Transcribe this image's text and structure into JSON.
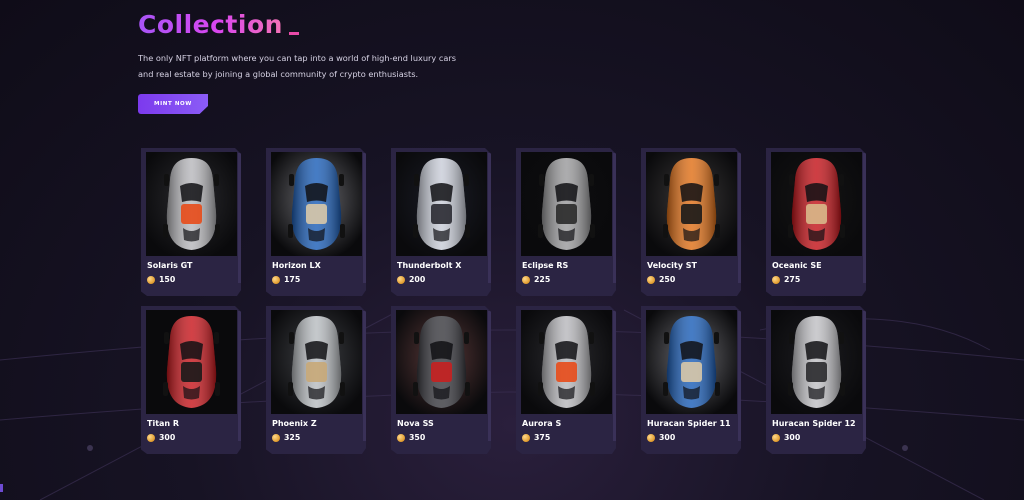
{
  "hero": {
    "title": "Collection",
    "description_line1": "The only NFT platform where you can tap into a world of high-end luxury cars",
    "description_line2": "and real estate by joining a global community of crypto enthusiasts.",
    "mint_label": "MINT NOW"
  },
  "colors": {
    "title_gradient_start": "#a855f7",
    "title_gradient_end": "#f472b6",
    "button": "#7c3aed",
    "card": "#2b2443",
    "coin": "#e09a2c"
  },
  "cards": [
    {
      "name": "Solaris GT",
      "price": "150",
      "car_color": "#b8b8bc",
      "bg": "#2a2a2e",
      "accent": "#e84b1a"
    },
    {
      "name": "Horizon LX",
      "price": "175",
      "car_color": "#1d5fb8",
      "bg": "#6b6b70",
      "accent": "#d8c8a8"
    },
    {
      "name": "Thunderbolt X",
      "price": "200",
      "car_color": "#c9cdd8",
      "bg": "#1a1c26",
      "accent": "#2a2a32"
    },
    {
      "name": "Eclipse RS",
      "price": "225",
      "car_color": "#9a9a9c",
      "bg": "#0d0d0f",
      "accent": "#2a2a2a"
    },
    {
      "name": "Velocity ST",
      "price": "250",
      "car_color": "#e07018",
      "bg": "#3a3838",
      "accent": "#1a1a1a"
    },
    {
      "name": "Oceanic SE",
      "price": "275",
      "car_color": "#c4141a",
      "bg": "#141414",
      "accent": "#d8b88a"
    },
    {
      "name": "Titan R",
      "price": "300",
      "car_color": "#c8181e",
      "bg": "#0a0a0c",
      "accent": "#1a1a1a"
    },
    {
      "name": "Phoenix Z",
      "price": "325",
      "car_color": "#b8bcc0",
      "bg": "#3e4044",
      "accent": "#c8a878"
    },
    {
      "name": "Nova SS",
      "price": "350",
      "car_color": "#3a3a40",
      "bg": "#5a3838",
      "accent": "#c82020"
    },
    {
      "name": "Aurora S",
      "price": "375",
      "car_color": "#b8b8bc",
      "bg": "#2a2a2e",
      "accent": "#e84b1a"
    },
    {
      "name": "Huracan Spider 11",
      "price": "300",
      "car_color": "#1d5fb8",
      "bg": "#6b6b70",
      "accent": "#d8c8a8"
    },
    {
      "name": "Huracan Spider 12",
      "price": "300",
      "car_color": "#c0c0c4",
      "bg": "#1c1c20",
      "accent": "#2a2a2e"
    }
  ]
}
